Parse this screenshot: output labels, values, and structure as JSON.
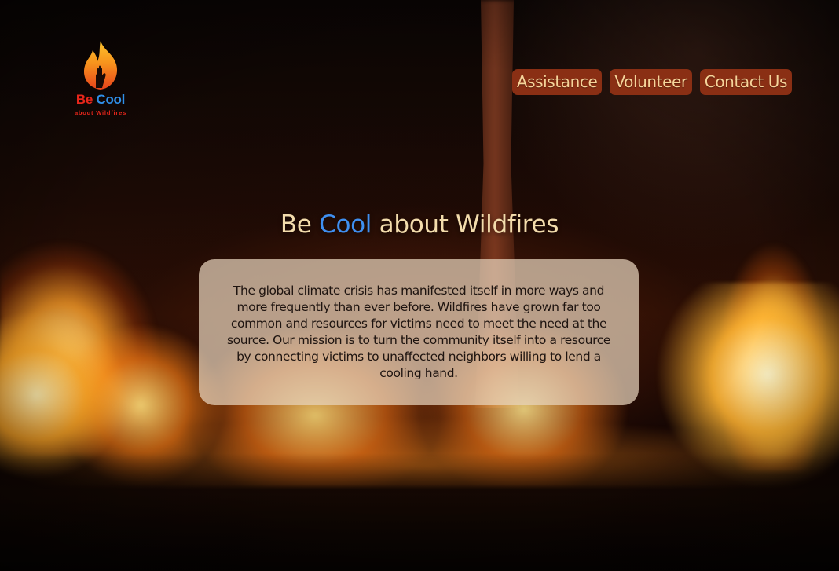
{
  "logo": {
    "title_be": "Be",
    "title_cool": "Cool",
    "subtitle": "about Wildfires",
    "icon": "flame-hand-icon"
  },
  "nav": {
    "items": [
      {
        "label": "Assistance"
      },
      {
        "label": "Volunteer"
      },
      {
        "label": "Contact Us"
      }
    ]
  },
  "hero": {
    "title_prefix": "Be ",
    "title_accent": "Cool",
    "title_suffix": " about Wildfires",
    "mission": "The global climate crisis has manifested itself in more ways and more frequently than ever before. Wildfires have grown far too common and resources for victims need to meet the need at the source. Our mission is to turn the community itself into a resource by connecting victims to unaffected neighbors willing to lend a cooling hand."
  },
  "colors": {
    "nav_button_bg": "#8a2f14",
    "nav_button_text": "#f6d49a",
    "title_text": "#f3dcac",
    "accent_blue": "#3f8ff0",
    "logo_red": "#e8261b",
    "logo_blue": "#2f8fe8"
  }
}
